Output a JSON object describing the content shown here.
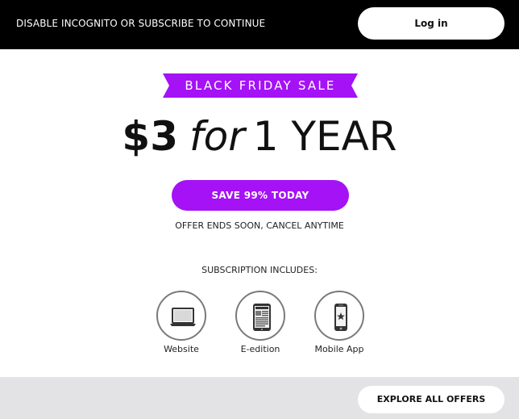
{
  "topbar": {
    "message": "DISABLE INCOGNITO OR SUBSCRIBE TO CONTINUE",
    "login_label": "Log in"
  },
  "promo": {
    "banner": "BLACK FRIDAY SALE",
    "price": "$3",
    "for_word": "for",
    "term": "1 YEAR",
    "cta_label": "SAVE 99% TODAY",
    "offer_note": "OFFER ENDS SOON, CANCEL ANYTIME",
    "accent_color": "#a412f5"
  },
  "includes": {
    "heading": "SUBSCRIPTION INCLUDES:",
    "items": [
      {
        "label": "Website",
        "icon": "laptop-icon"
      },
      {
        "label": "E-edition",
        "icon": "tablet-newspaper-icon"
      },
      {
        "label": "Mobile App",
        "icon": "smartphone-star-icon"
      }
    ]
  },
  "footer": {
    "explore_label": "EXPLORE ALL OFFERS"
  }
}
